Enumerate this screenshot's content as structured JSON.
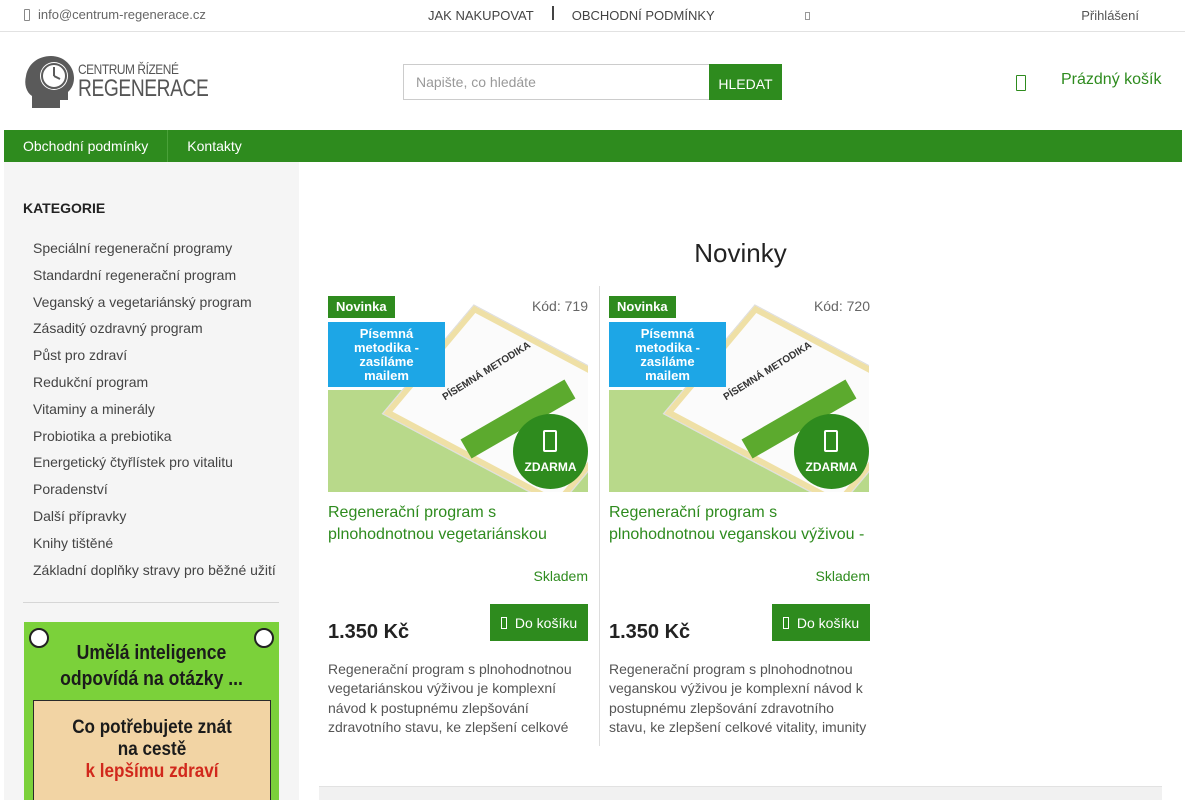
{
  "topbar": {
    "email": "info@centrum-regenerace.cz",
    "links": [
      "JAK NAKUPOVAT",
      "OBCHODNÍ PODMÍNKY"
    ],
    "login": "Přihlášení"
  },
  "header": {
    "logo_line1": "CENTRUM ŘÍZENÉ",
    "logo_line2": "REGENERACE",
    "search_placeholder": "Napište, co hledáte",
    "search_button": "HLEDAT",
    "cart_label": "Prázdný košík"
  },
  "nav": {
    "items": [
      "Obchodní podmínky",
      "Kontakty"
    ]
  },
  "sidebar": {
    "title": "KATEGORIE",
    "categories": [
      "Speciální regenerační programy",
      "Standardní regenerační program",
      "Veganský a vegetariánský program",
      "Zásaditý ozdravný program",
      "Půst pro zdraví",
      "Redukční program",
      "Vitaminy a minerály",
      "Probiotika a prebiotika",
      "Energetický čtyřlístek pro vitalitu",
      "Poradenství",
      "Další přípravky",
      "Knihy tištěné",
      "Základní doplňky stravy pro běžné užití"
    ],
    "banner": {
      "head_line1": "Umělá inteligence",
      "head_line2": "odpovídá na otázky ...",
      "card_line1": "Co potřebujete znát",
      "card_line2": "na cestě",
      "card_line3": "k lepšímu zdraví"
    }
  },
  "main": {
    "title": "Novinky",
    "products": [
      {
        "badge_new": "Novinka",
        "badge_mail": "Písemná metodika - zasíláme mailem",
        "code": "Kód: 719",
        "free": "ZDARMA",
        "book_label": "PÍSEMNÁ METODIKA",
        "name": "Regenerační program s plnohodnotnou vegetariánskou",
        "stock": "Skladem",
        "price": "1.350 Kč",
        "buy": "Do košíku",
        "description": "Regenerační program s plnohodnotnou vegetariánskou výživou je komplexní návod k postupnému zlepšování zdravotního stavu, ke zlepšení celkové"
      },
      {
        "badge_new": "Novinka",
        "badge_mail": "Písemná metodika - zasíláme mailem",
        "code": "Kód: 720",
        "free": "ZDARMA",
        "book_label": "PÍSEMNÁ METODIKA",
        "name": "Regenerační program s plnohodnotnou veganskou výživou -",
        "stock": "Skladem",
        "price": "1.350 Kč",
        "buy": "Do košíku",
        "description": "Regenerační program s plnohodnotnou veganskou výživou je komplexní návod k postupnému zlepšování zdravotního stavu, ke zlepšení celkové vitality, imunity"
      }
    ]
  },
  "colors": {
    "brand_green": "#2e8b1e",
    "badge_blue": "#1da6e6"
  }
}
